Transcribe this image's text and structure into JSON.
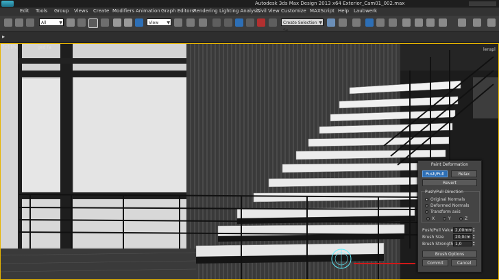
{
  "window": {
    "title": "Autodesk 3ds Max Design 2013 x64     Exterior_Cam01_002.max"
  },
  "menu": {
    "items": [
      "Edit",
      "Tools",
      "Group",
      "Views",
      "Create",
      "Modifiers",
      "Animation",
      "Graph Editors",
      "Rendering",
      "Lighting Analysis",
      "Civil View",
      "Customize",
      "MAXScript",
      "Help",
      "Laubwerk"
    ]
  },
  "toolbar": {
    "selection_filter": "All",
    "ref_coord": "View",
    "named_selection": "Create Selection Se"
  },
  "viewport": {
    "label": "[+] [Pe",
    "label_tail": "ged Fa",
    "right_hint": "lenspl"
  },
  "paint_deformation": {
    "title": "Paint Deformation",
    "push_pull_label": "Push/Pull",
    "relax_label": "Relax",
    "revert_label": "Revert",
    "direction_title": "Push/Pull Direction",
    "original_normals_label": "Original Normals",
    "deformed_normals_label": "Deformed Normals",
    "transform_axis_label": "Transform axis",
    "axis_x": "X",
    "axis_y": "Y",
    "axis_z": "Z",
    "push_pull_value_label": "Push/Pull Value",
    "push_pull_value": "2,00mm",
    "brush_size_label": "Brush Size",
    "brush_size": "20,0cm",
    "brush_strength_label": "Brush Strength",
    "brush_strength": "1,0",
    "brush_options_label": "Brush Options",
    "commit_label": "Commit",
    "cancel_label": "Cancel"
  },
  "colors": {
    "active_button": "#2d6fb6",
    "viewport_border": "#e8b500",
    "brush_cursor": "#5ff0ff",
    "annotation_arrow": "#d01818"
  }
}
